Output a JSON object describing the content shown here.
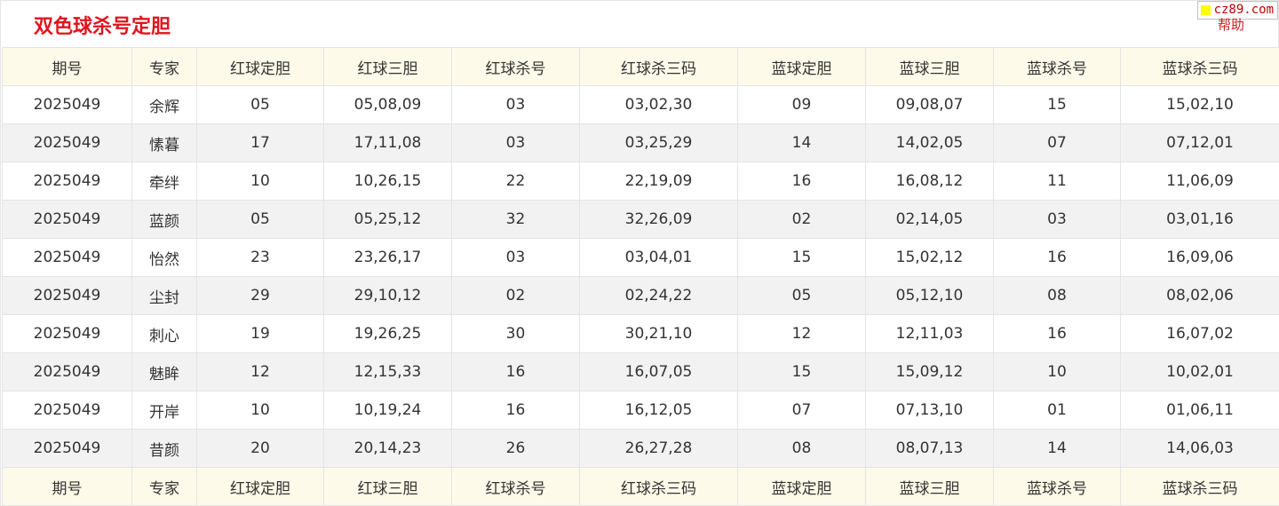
{
  "header": {
    "title": "双色球杀号定胆",
    "brand": "cz89.com",
    "help_label": "帮助"
  },
  "colors": {
    "title": "#e0141e",
    "header_bg": "#fefae9",
    "stripe_bg": "#f2f2f2",
    "brand_square": "#ffff00",
    "brand_text": "#c00000"
  },
  "table": {
    "columns": [
      "期号",
      "专家",
      "红球定胆",
      "红球三胆",
      "红球杀号",
      "红球杀三码",
      "蓝球定胆",
      "蓝球三胆",
      "蓝球杀号",
      "蓝球杀三码"
    ],
    "rows": [
      [
        "2025049",
        "余辉",
        "05",
        "05,08,09",
        "03",
        "03,02,30",
        "09",
        "09,08,07",
        "15",
        "15,02,10"
      ],
      [
        "2025049",
        "愫暮",
        "17",
        "17,11,08",
        "03",
        "03,25,29",
        "14",
        "14,02,05",
        "07",
        "07,12,01"
      ],
      [
        "2025049",
        "牵绊",
        "10",
        "10,26,15",
        "22",
        "22,19,09",
        "16",
        "16,08,12",
        "11",
        "11,06,09"
      ],
      [
        "2025049",
        "蓝颜",
        "05",
        "05,25,12",
        "32",
        "32,26,09",
        "02",
        "02,14,05",
        "03",
        "03,01,16"
      ],
      [
        "2025049",
        "怡然",
        "23",
        "23,26,17",
        "03",
        "03,04,01",
        "15",
        "15,02,12",
        "16",
        "16,09,06"
      ],
      [
        "2025049",
        "尘封",
        "29",
        "29,10,12",
        "02",
        "02,24,22",
        "05",
        "05,12,10",
        "08",
        "08,02,06"
      ],
      [
        "2025049",
        "刺心",
        "19",
        "19,26,25",
        "30",
        "30,21,10",
        "12",
        "12,11,03",
        "16",
        "16,07,02"
      ],
      [
        "2025049",
        "魅眸",
        "12",
        "12,15,33",
        "16",
        "16,07,05",
        "15",
        "15,09,12",
        "10",
        "10,02,01"
      ],
      [
        "2025049",
        "开岸",
        "10",
        "10,19,24",
        "16",
        "16,12,05",
        "07",
        "07,13,10",
        "01",
        "01,06,11"
      ],
      [
        "2025049",
        "昔颜",
        "20",
        "20,14,23",
        "26",
        "26,27,28",
        "08",
        "08,07,13",
        "14",
        "14,06,03"
      ]
    ]
  }
}
